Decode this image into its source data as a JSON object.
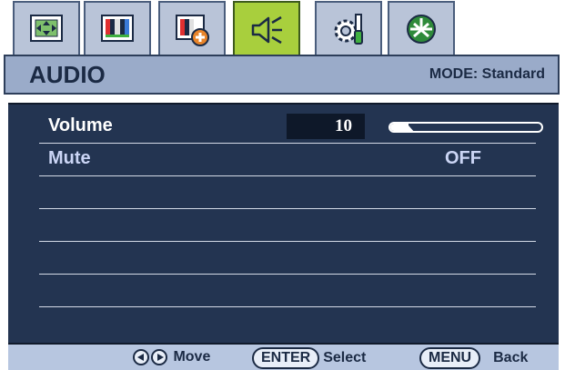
{
  "tabs": [
    {
      "icon": "picture-position-icon",
      "active": false
    },
    {
      "icon": "color-bars-icon",
      "active": false
    },
    {
      "icon": "picture-advanced-icon",
      "active": false
    },
    {
      "icon": "speaker-icon",
      "active": true
    },
    {
      "icon": "system-gear-icon",
      "active": false
    },
    {
      "icon": "energy-saving-icon",
      "active": false
    }
  ],
  "header": {
    "title": "AUDIO",
    "mode": "MODE: Standard"
  },
  "settings": {
    "volume": {
      "label": "Volume",
      "value": "10",
      "slider_fraction": 0.12
    },
    "mute": {
      "label": "Mute",
      "value": "OFF"
    }
  },
  "footer": {
    "move_label": "Move",
    "enter_key": "ENTER",
    "select_label": "Select",
    "menu_key": "MENU",
    "back_label": "Back"
  },
  "colors": {
    "panel": "#233451",
    "active_tab": "#a8cf3d",
    "selected_label": "#ffffff",
    "label": "#cbd5f5"
  }
}
